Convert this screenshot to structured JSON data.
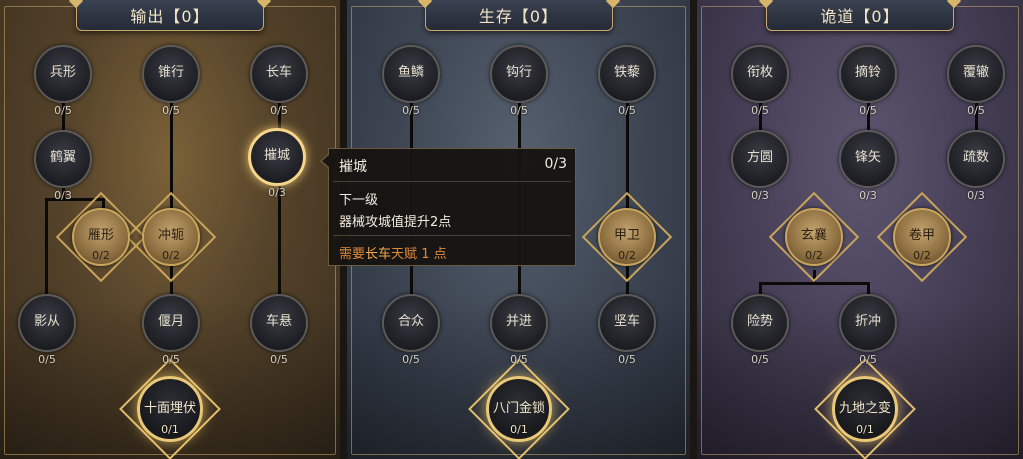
{
  "panels": {
    "output": {
      "title": "输出【0】"
    },
    "survival": {
      "title": "生存【0】"
    },
    "trick": {
      "title": "诡道【0】"
    }
  },
  "output_nodes": {
    "bingxing": {
      "label": "兵形",
      "count": "0/5"
    },
    "zhuixing": {
      "label": "锥行",
      "count": "0/5"
    },
    "changche": {
      "label": "长车",
      "count": "0/5"
    },
    "heyi": {
      "label": "鹤翼",
      "count": "0/3"
    },
    "cuicheng": {
      "label": "摧城",
      "count": "0/3"
    },
    "yanxing": {
      "label": "雁形",
      "count": "0/2"
    },
    "chongni": {
      "label": "冲轭",
      "count": "0/2"
    },
    "yingcong": {
      "label": "影从",
      "count": "0/5"
    },
    "yanyue": {
      "label": "偃月",
      "count": "0/5"
    },
    "chexuan": {
      "label": "车悬",
      "count": "0/5"
    },
    "shimian": {
      "label": "十面埋伏",
      "count": "0/1"
    }
  },
  "survival_nodes": {
    "yulin": {
      "label": "鱼鳞",
      "count": "0/5"
    },
    "gouxing": {
      "label": "钩行",
      "count": "0/5"
    },
    "tieli": {
      "label": "铁藜",
      "count": "0/5"
    },
    "jiawei": {
      "label": "甲卫",
      "count": "0/2"
    },
    "hezhong": {
      "label": "合众",
      "count": "0/5"
    },
    "bingjin": {
      "label": "并进",
      "count": "0/5"
    },
    "jianche": {
      "label": "坚车",
      "count": "0/5"
    },
    "bamen": {
      "label": "八门金锁",
      "count": "0/1"
    }
  },
  "trick_nodes": {
    "hengmei": {
      "label": "衔枚",
      "count": "0/5"
    },
    "zhailing": {
      "label": "摘铃",
      "count": "0/5"
    },
    "fuzhe": {
      "label": "覆辙",
      "count": "0/5"
    },
    "fangyuan": {
      "label": "方圆",
      "count": "0/3"
    },
    "fengshi": {
      "label": "锋矢",
      "count": "0/3"
    },
    "shushu": {
      "label": "疏数",
      "count": "0/3"
    },
    "xuanxiang": {
      "label": "玄襄",
      "count": "0/2"
    },
    "juanjia": {
      "label": "卷甲",
      "count": "0/2"
    },
    "xianshi": {
      "label": "险势",
      "count": "0/5"
    },
    "zhechong": {
      "label": "折冲",
      "count": "0/5"
    },
    "jiudi": {
      "label": "九地之变",
      "count": "0/1"
    }
  },
  "tooltip": {
    "title": "摧城",
    "count": "0/3",
    "next_level": "下一级",
    "description": "器械攻城值提升2点",
    "req_prefix": "需要",
    "req_talent": "长车",
    "req_mid": "天赋",
    "req_points": "1 点"
  },
  "colors": {
    "output_bg": "#55432a",
    "survival_bg": "#3e4654",
    "trick_bg": "#463f56",
    "gold_frame": "#c8a86a",
    "req_text": "#e08a3a"
  }
}
